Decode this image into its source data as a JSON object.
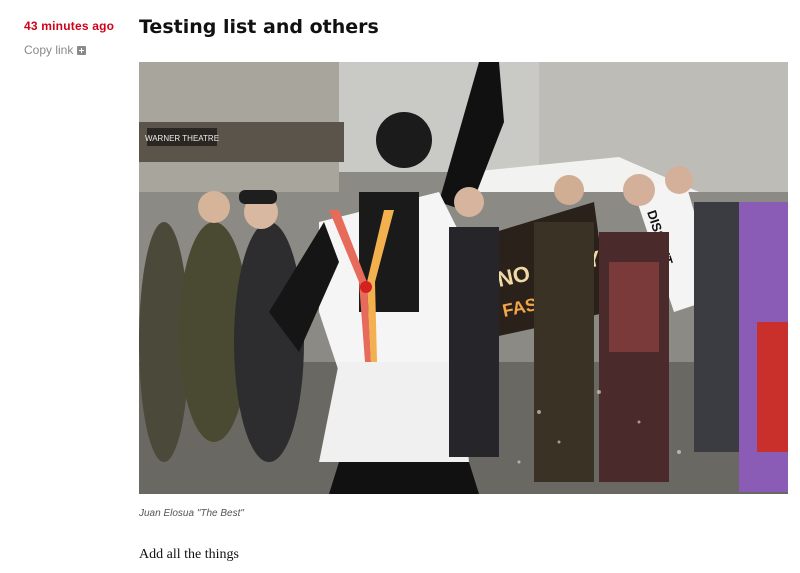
{
  "post": {
    "timestamp": "43 minutes ago",
    "copy_link": "Copy link",
    "title": "Testing list and others",
    "caption": "Juan Elosua \"The Best\"",
    "body": "Add all the things"
  },
  "photo": {
    "sign_text": "NO UNITY WITH FASCISTS",
    "sign2_text": "DISSENT ENCOURAGES DEMOCRACY",
    "marquee_text": "WARNER THEATRE"
  },
  "colors": {
    "accent": "#d0021b",
    "muted": "#8a8a8a"
  }
}
